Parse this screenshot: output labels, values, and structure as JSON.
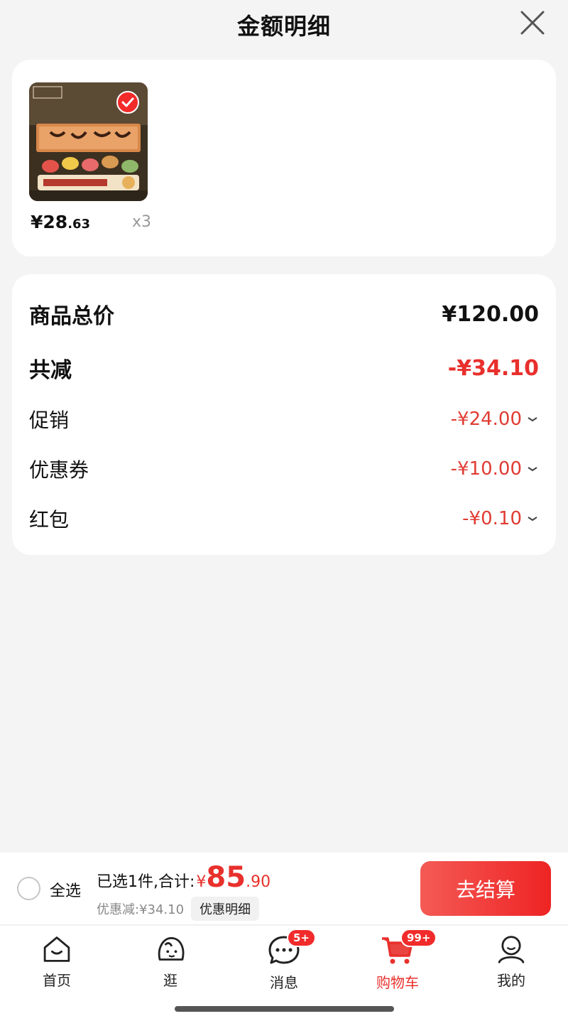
{
  "header": {
    "title": "金额明细",
    "close_icon": "close-icon"
  },
  "product": {
    "image_desc": "mooncake-gift-box-image",
    "price_int": "¥28",
    "price_dec": ".63",
    "quantity": "x3",
    "selected": true
  },
  "summary": {
    "total_label": "商品总价",
    "total_value": "¥120.00",
    "reduce_label": "共减",
    "reduce_value": "-¥34.10",
    "items": [
      {
        "label": "促销",
        "value": "-¥24.00"
      },
      {
        "label": "优惠券",
        "value": "-¥10.00"
      },
      {
        "label": "红包",
        "value": "-¥0.10"
      }
    ]
  },
  "checkout": {
    "select_all": "全选",
    "selected_text": "已选1件,合计:",
    "currency": "¥",
    "total_int": "85",
    "total_dec": ".90",
    "discount_text": "优惠减:¥34.10",
    "detail_button": "优惠明细",
    "pay_button": "去结算"
  },
  "tabbar": {
    "tabs": [
      {
        "label": "首页",
        "icon": "home-icon"
      },
      {
        "label": "逛",
        "icon": "browse-icon"
      },
      {
        "label": "消息",
        "icon": "message-icon",
        "badge": "5+"
      },
      {
        "label": "购物车",
        "icon": "cart-icon",
        "badge": "99+",
        "active": true
      },
      {
        "label": "我的",
        "icon": "profile-icon"
      }
    ]
  },
  "colors": {
    "accent": "#e8302c",
    "background": "#f4f4f4"
  }
}
